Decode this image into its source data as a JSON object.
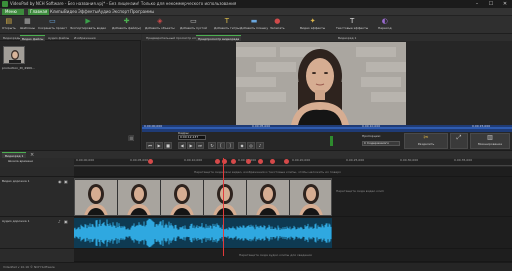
{
  "window": {
    "title": "VideoPad by NCH Software - Без названия.vpj* - Без лицензии! Только для некоммерческого использования",
    "controls": [
      "–",
      "☐",
      "✕"
    ]
  },
  "menubar": {
    "main": "Меню",
    "items": [
      "Главная",
      "Клипы",
      "Видео",
      "Эффекты",
      "Аудио",
      "Экспорт",
      "Программы"
    ],
    "active": "Главная"
  },
  "toolbar": [
    {
      "label": "Открыть",
      "icon": "folder-open-icon",
      "glyph": "▤",
      "color": "#e0b84a"
    },
    {
      "label": "Шаблоны",
      "icon": "template-icon",
      "glyph": "▦",
      "color": "#b0b0b0"
    },
    {
      "label": "Сохранить проект",
      "icon": "save-icon",
      "glyph": "▭",
      "color": "#6aa8e0"
    },
    {
      "label": "Экспортировать видео",
      "icon": "export-icon",
      "glyph": "▶",
      "color": "#3aa04a"
    },
    {
      "label": "Добавить файл(ы)",
      "icon": "add-file-icon",
      "glyph": "✚",
      "color": "#4caf50"
    },
    {
      "label": "Добавить объекты",
      "icon": "add-objects-icon",
      "glyph": "◈",
      "color": "#d04a4a"
    },
    {
      "label": "Добавить пустой",
      "icon": "add-blank-icon",
      "glyph": "▭",
      "color": "#c0c0c0"
    },
    {
      "label": "Добавить титры",
      "icon": "add-titles-icon",
      "glyph": "T",
      "color": "#e0c04a"
    },
    {
      "label": "Добавить плашку",
      "icon": "add-banner-icon",
      "glyph": "▬",
      "color": "#6aa8e0"
    },
    {
      "label": "Записать",
      "icon": "record-icon",
      "glyph": "●",
      "color": "#d04a4a"
    },
    {
      "label": "Видео эффекты",
      "icon": "video-effects-icon",
      "glyph": "✦",
      "color": "#e0b84a"
    },
    {
      "label": "Текстовые эффекты",
      "icon": "text-effects-icon",
      "glyph": "T",
      "color": "#e0e0e0"
    },
    {
      "label": "Переход",
      "icon": "transition-icon",
      "glyph": "◐",
      "color": "#9a6ad0"
    }
  ],
  "left_panel": {
    "tabs": [
      "Видеоряды",
      "Видео файлы",
      "Аудио файлы",
      "Изображения"
    ],
    "active_tab": "Видео файлы",
    "file": {
      "caption": "production_ID_4969..."
    }
  },
  "preview": {
    "tabs": [
      "Предварительный просмотр клипа",
      "Предпросмотр видеоряда"
    ],
    "active_tab": "Предпросмотр видеоряда",
    "sequence_label": "Видеоряд 1",
    "scrub_times": [
      "0.00.00,000",
      "0.00.05,000",
      "0.00.10,000",
      "0.00.15,000"
    ],
    "timecode_label": "Кадры:",
    "timecode": "0:00:12,137",
    "ratio_label": "Пропорции:",
    "ratio_value": "С Содержимого",
    "split_label": "Разделить",
    "fullscreen_label": "Развернуть",
    "audio_label": "Микширование"
  },
  "timeline": {
    "tab": "Видеоряд 1",
    "ruler_label": "Шкала времени",
    "ruler_ticks": [
      "0.00.00,000",
      "0.00.05,000",
      "0.00.10,000",
      "0.00.15,000",
      "0.00.20,000",
      "0.00.25,000",
      "0.00.30,000",
      "0.00.35,000"
    ],
    "video_track_name": "Видео дорожка 1",
    "audio_track_name": "Аудио дорожка 1",
    "hint_overlay": "Перетащите сюда свои видео, изображения и текстовые клипы, чтобы наложить их поверх",
    "hint_video_track": "Перетащите сюда видео клип",
    "hint_audio": "Перетащите сюда аудио клипы для сведения"
  },
  "status": {
    "text": "VideoPad v 10.16 © NCH Software"
  },
  "colors": {
    "accent": "#3d8b3d",
    "audio_wave": "#2fa8e0",
    "playhead": "#e23a3a",
    "scrub_bar": "#1f3b75"
  }
}
